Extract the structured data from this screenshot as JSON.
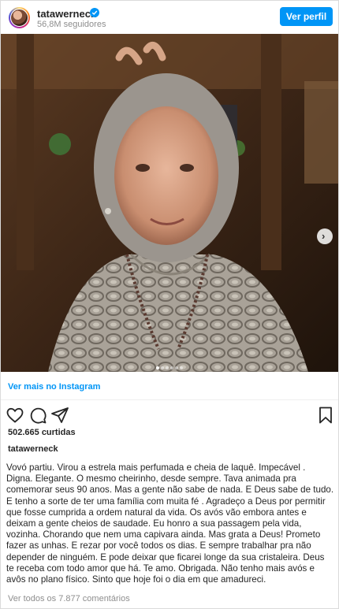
{
  "header": {
    "username": "tatawerneck",
    "followers": "56,8M seguidores",
    "profile_button": "Ver perfil"
  },
  "post": {
    "carousel": {
      "slide_count": 6,
      "active_slide": 1
    },
    "view_more": "Ver mais no Instagram",
    "likes": "502.665 curtidas",
    "caption_user": "tatawerneck",
    "caption": "Vovó partiu. Virou a estrela mais perfumada e cheia de laquê. Impecável . Digna. Elegante. O mesmo cheirinho, desde sempre. Tava animada pra comemorar seus 90 anos. Mas a gente não sabe de nada. E Deus sabe de tudo. E tenho a sorte de ter uma família com muita fé . Agradeço a Deus por permitir que fosse cumprida a ordem natural da vida. Os avós vão embora antes e deixam a gente cheios de saudade. Eu honro a sua passagem pela vida, vozinha. Chorando que nem uma capivara ainda. Mas grata a Deus! Prometo fazer as unhas. E rezar por você todos os dias. E sempre trabalhar pra não depender de ninguém. E pode deixar que ficarei longe da sua cristaleira. Deus te receba com todo amor que há. Te amo. Obrigada. Não tenho mais avós e avôs no plano físico. Sinto que hoje foi o dia em que amadureci.",
    "comments_link": "Ver todos os 7.877 comentários"
  },
  "colors": {
    "accent": "#0095f6",
    "text": "#262626",
    "muted": "#8e8e8e"
  }
}
